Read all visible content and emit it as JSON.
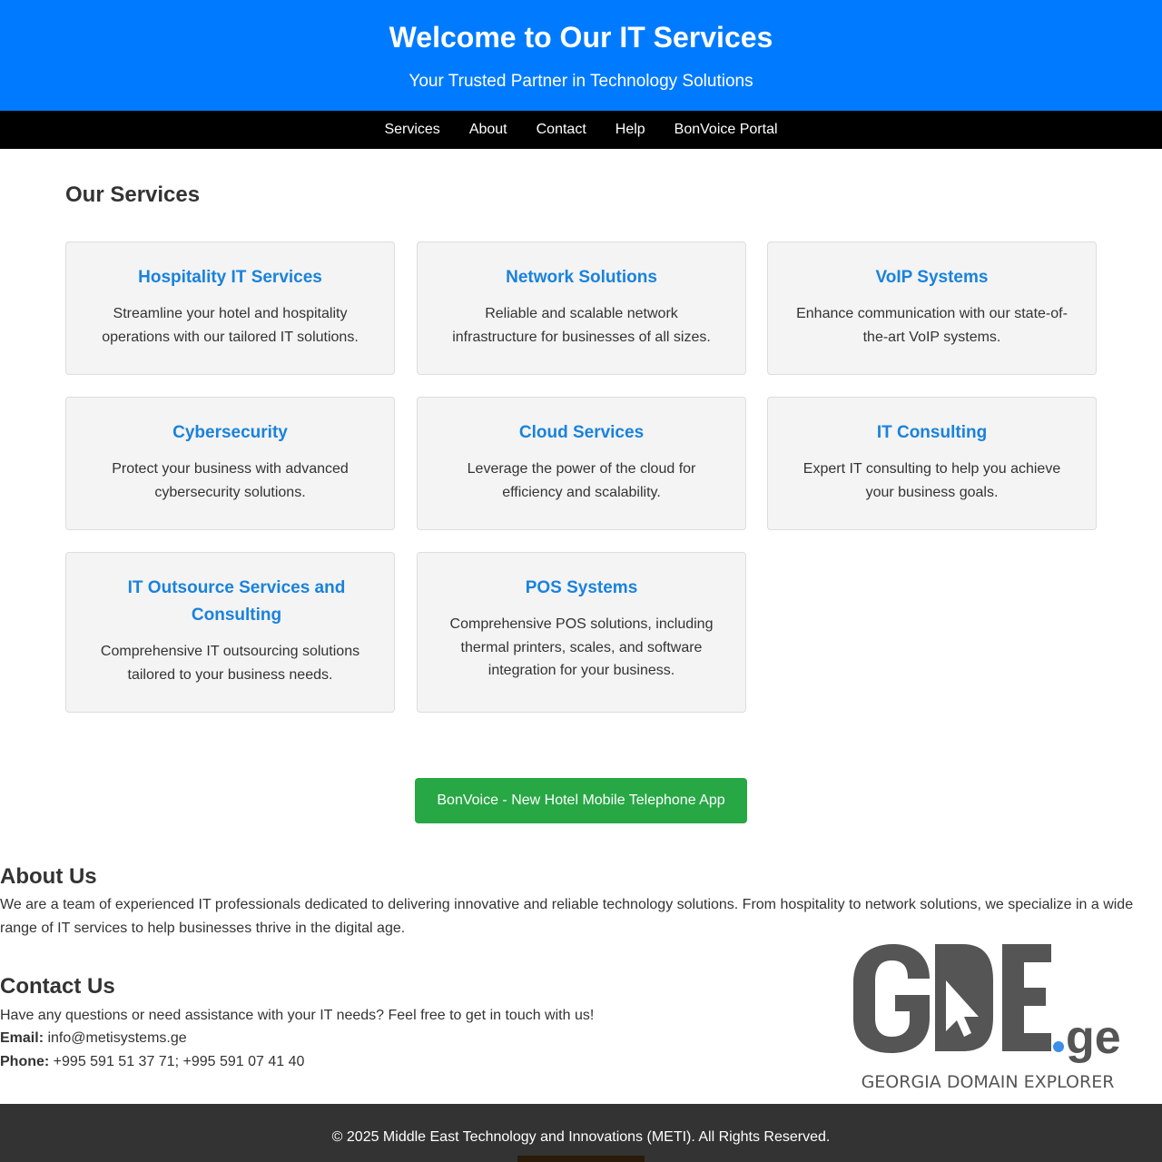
{
  "header": {
    "title": "Welcome to Our IT Services",
    "subtitle": "Your Trusted Partner in Technology Solutions"
  },
  "nav": {
    "items": [
      "Services",
      "About",
      "Contact",
      "Help",
      "BonVoice Portal"
    ]
  },
  "services": {
    "heading": "Our Services",
    "cards": [
      {
        "title": "Hospitality IT Services",
        "desc": "Streamline your hotel and hospitality operations with our tailored IT solutions."
      },
      {
        "title": "Network Solutions",
        "desc": "Reliable and scalable network infrastructure for businesses of all sizes."
      },
      {
        "title": "VoIP Systems",
        "desc": "Enhance communication with our state-of-the-art VoIP systems."
      },
      {
        "title": "Cybersecurity",
        "desc": "Protect your business with advanced cybersecurity solutions."
      },
      {
        "title": "Cloud Services",
        "desc": "Leverage the power of the cloud for efficiency and scalability."
      },
      {
        "title": "IT Consulting",
        "desc": "Expert IT consulting to help you achieve your business goals."
      },
      {
        "title": "IT Outsource Services and Consulting",
        "desc": "Comprehensive IT outsourcing solutions tailored to your business needs."
      },
      {
        "title": "POS Systems",
        "desc": "Comprehensive POS solutions, including thermal printers, scales, and software integration for your business."
      }
    ]
  },
  "cta": {
    "label": "BonVoice - New Hotel Mobile Telephone App",
    "color": "#28a745"
  },
  "about": {
    "heading": "About Us",
    "text": "We are a team of experienced IT professionals dedicated to delivering innovative and reliable technology solutions. From hospitality to network solutions, we specialize in a wide range of IT services to help businesses thrive in the digital age."
  },
  "contact": {
    "heading": "Contact Us",
    "intro": "Have any questions or need assistance with your IT needs? Feel free to get in touch with us!",
    "email_label": "Email:",
    "email": "info@metisystems.ge",
    "phone_label": "Phone:",
    "phone": "+995 591 51 37 71; +995 591 07 41 40"
  },
  "logo": {
    "main": "GDE",
    "tld": ".ge",
    "tagline": "GEORGIA DOMAIN EXPLORER"
  },
  "footer": {
    "text": "© 2025 Middle East Technology and Innovations (METI). All Rights Reserved."
  },
  "colors": {
    "header_bg": "#007bff",
    "nav_bg": "#000000",
    "card_title": "#1a82dc",
    "footer_bg": "#333333"
  }
}
